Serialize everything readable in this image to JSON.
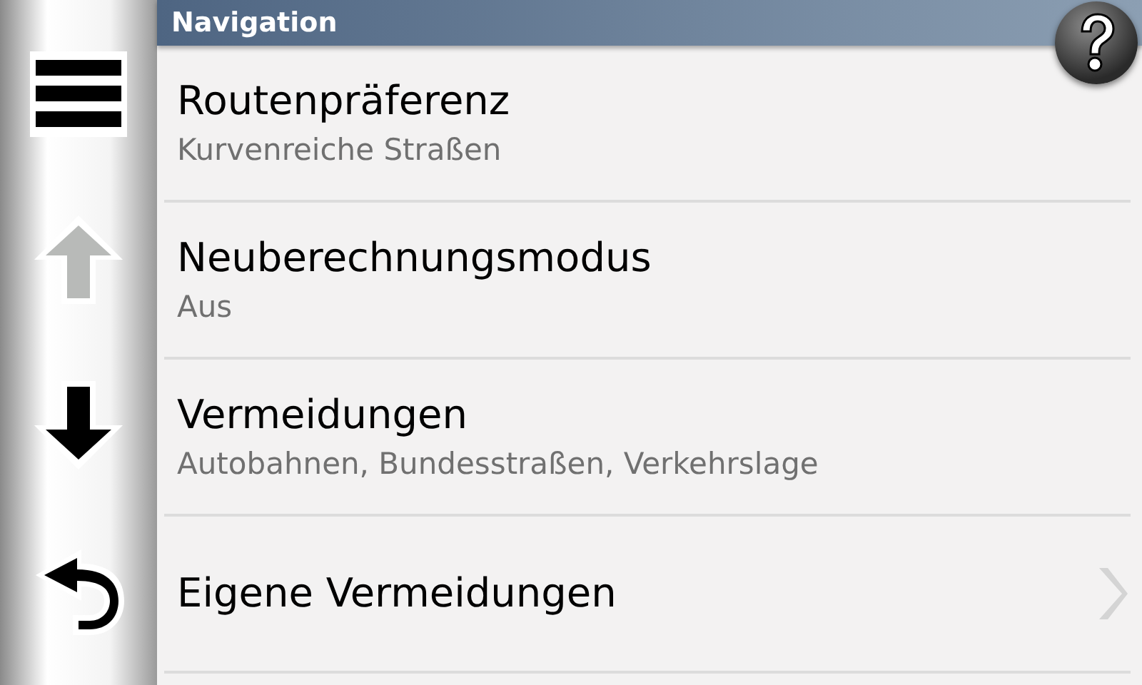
{
  "header": {
    "title": "Navigation"
  },
  "sidebar": [
    {
      "kind": "menu",
      "disabled": false
    },
    {
      "kind": "up",
      "disabled": true
    },
    {
      "kind": "down",
      "disabled": false
    },
    {
      "kind": "back",
      "disabled": false
    }
  ],
  "items": [
    {
      "kind": "setting",
      "title": "Routenpräferenz",
      "value": "Kurvenreiche Straßen"
    },
    {
      "kind": "setting",
      "title": "Neuberechnungsmodus",
      "value": "Aus"
    },
    {
      "kind": "setting",
      "title": "Vermeidungen",
      "value": "Autobahnen, Bundesstraßen, Verkehrslage"
    },
    {
      "kind": "submenu",
      "title": "Eigene Vermeidungen"
    }
  ]
}
